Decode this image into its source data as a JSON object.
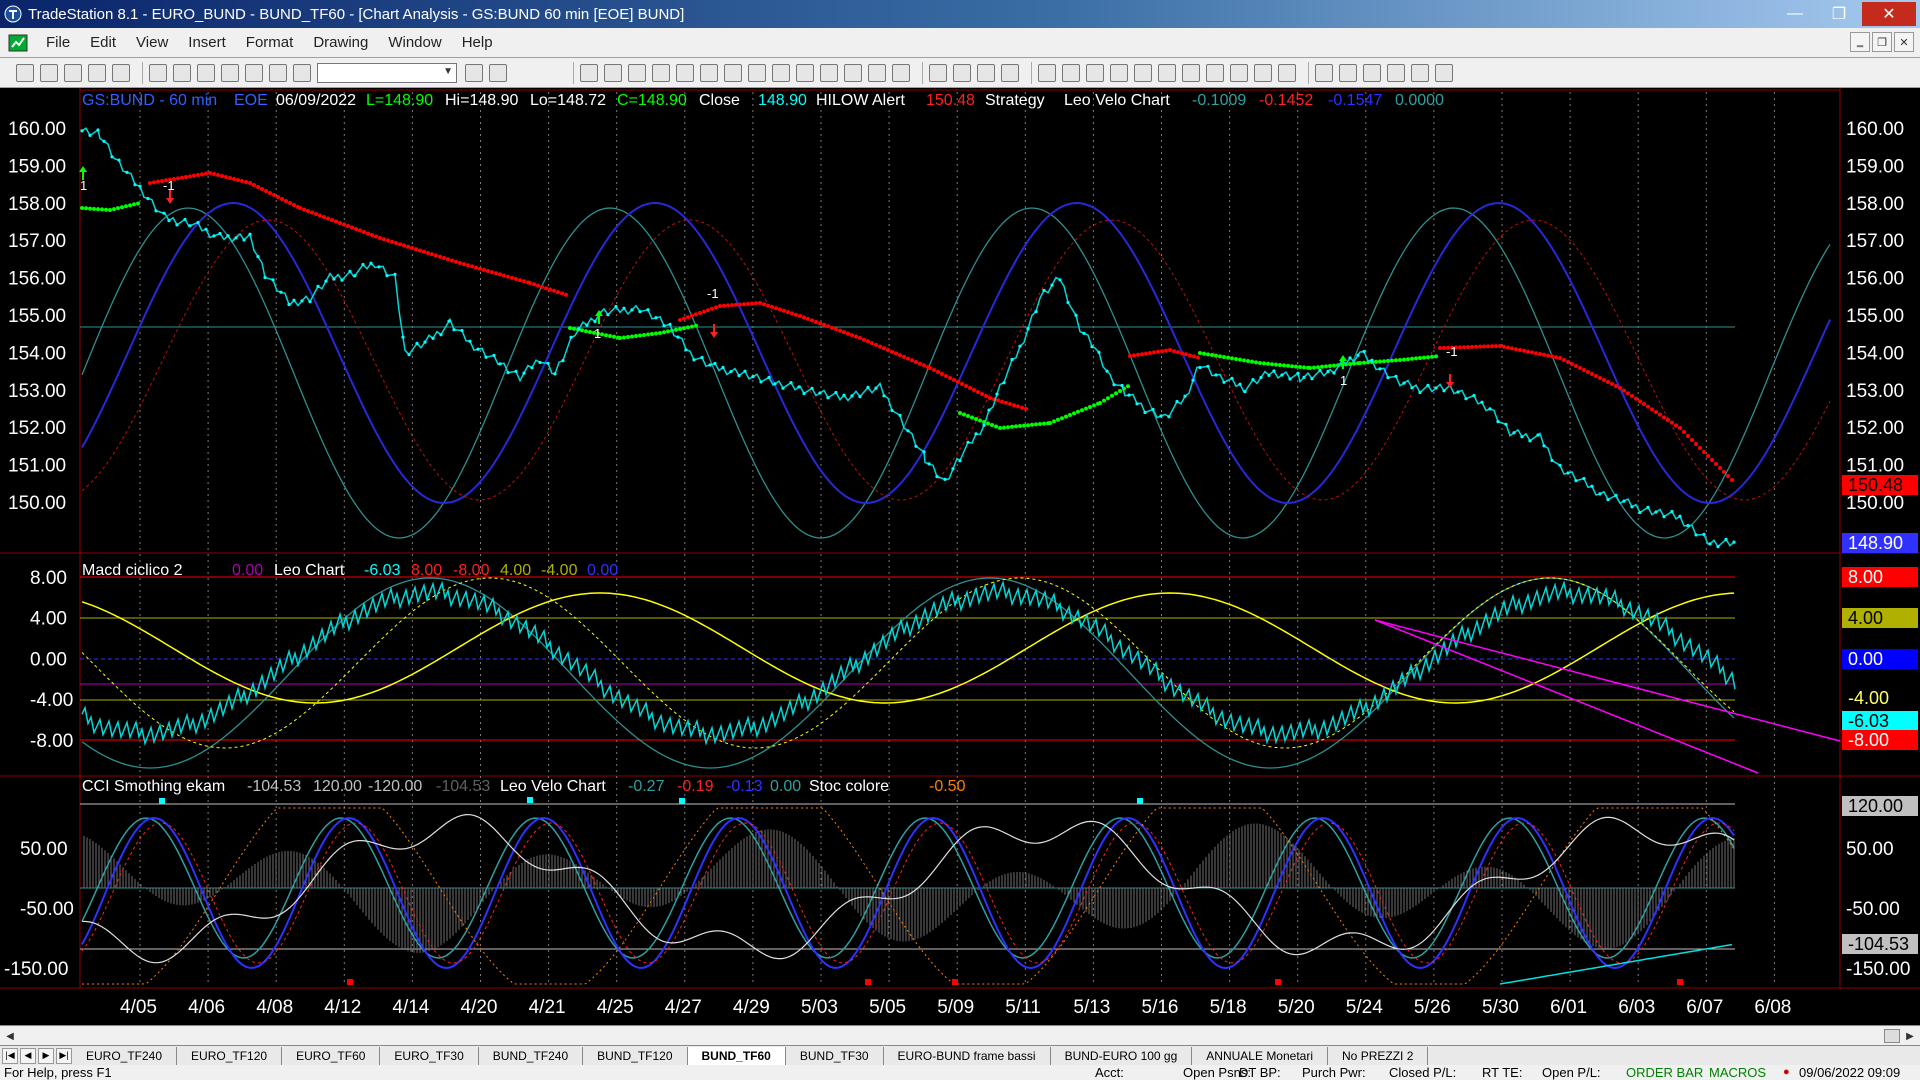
{
  "window": {
    "title": "TradeStation 8.1 - EURO_BUND - BUND_TF60 - [Chart Analysis - GS:BUND  60 min  [EOE] BUND]",
    "min": "—",
    "max": "❐",
    "close": "✕"
  },
  "menu": [
    "File",
    "Edit",
    "View",
    "Insert",
    "Format",
    "Drawing",
    "Window",
    "Help"
  ],
  "mdi_buttons": [
    "‗",
    "❐",
    "✕"
  ],
  "chart": {
    "symbol": "GS:BUND - 60 min",
    "session": "EOE",
    "date": "06/09/2022",
    "last": "L=148.90",
    "high": "Hi=148.90",
    "low": "Lo=148.72",
    "close_label": "C=148.90",
    "close_word": "Close",
    "close_value": "148.90",
    "study1_name": "HILOW Alert",
    "study1_value": "150.48",
    "study2_name": "Strategy",
    "study3_name": "Leo Velo Chart",
    "study3_v1": "-0.1009",
    "study3_v2": "-0.1452",
    "study3_v3": "-0.1547",
    "study3_v4": "0.0000",
    "price_ticks": [
      "160.00",
      "159.00",
      "158.00",
      "157.00",
      "156.00",
      "155.00",
      "154.00",
      "153.00",
      "152.00",
      "151.00",
      "150.00"
    ],
    "price_tag_red": "150.48",
    "price_tag_blue": "148.90",
    "signals": {
      "s1": "1",
      "s2": "-1",
      "s3": "1",
      "s4": "-1",
      "s5": "1",
      "s6": "-1"
    }
  },
  "macd_panel": {
    "name": "Macd ciclico 2",
    "v0": "0.00",
    "sub": "Leo Chart",
    "vals": [
      "-6.03",
      "8.00",
      "-8.00",
      "4.00",
      "-4.00",
      "0.00"
    ],
    "ticks": [
      "8.00",
      "4.00",
      "0.00",
      "-4.00",
      "-8.00"
    ],
    "tags": [
      "8.00",
      "4.00",
      "0.00",
      "-4.00",
      "-6.03",
      "-8.00"
    ]
  },
  "cci_panel": {
    "name": "CCI Smothing ekam",
    "vals": [
      "-104.53",
      "120.00",
      "-120.00",
      "-104.53"
    ],
    "sub": "Leo Velo Chart",
    "sub_vals": [
      "-0.27",
      "-0.19",
      "-0.13",
      "0.00"
    ],
    "sub2": "Stoc colore",
    "sub2_val": "-0.50",
    "ticks": [
      "50.00",
      "-50.00",
      "-150.00"
    ],
    "tags": [
      "120.00",
      "50.00",
      "-50.00",
      "-104.53",
      "-150.00"
    ]
  },
  "x_axis": [
    "4/05",
    "4/06",
    "4/08",
    "4/12",
    "4/14",
    "4/20",
    "4/21",
    "4/25",
    "4/27",
    "4/29",
    "5/03",
    "5/05",
    "5/09",
    "5/11",
    "5/13",
    "5/16",
    "5/18",
    "5/20",
    "5/24",
    "5/26",
    "5/30",
    "6/01",
    "6/03",
    "6/07",
    "6/08"
  ],
  "tabs": [
    "EURO_TF240",
    "EURO_TF120",
    "EURO_TF60",
    "EURO_TF30",
    "BUND_TF240",
    "BUND_TF120",
    "BUND_TF60",
    "BUND_TF30",
    "EURO-BUND frame bassi",
    "BUND-EURO 100 gg",
    "ANNUALE Monetari",
    "No PREZZI 2"
  ],
  "active_tab": "BUND_TF60",
  "status": {
    "help": "For Help, press F1",
    "acct": "Acct:",
    "open_psns": "Open Psns:",
    "dt_bp": "DT BP:",
    "purch_pwr": "Purch Pwr:",
    "closed_pl": "Closed P/L:",
    "rt_te": "RT TE:",
    "open_pl": "Open P/L:",
    "order_bar": "ORDER BAR",
    "macros": "MACROS",
    "datetime": "09/06/2022 09:09"
  },
  "colors": {
    "price": "#00ffff",
    "strategy_up": "#00ff00",
    "strategy_down": "#ff0000",
    "wave_blue": "#3030ff",
    "wave_teal": "#2f8f8f",
    "yellow": "#ffff00",
    "magenta": "#ff00ff"
  }
}
